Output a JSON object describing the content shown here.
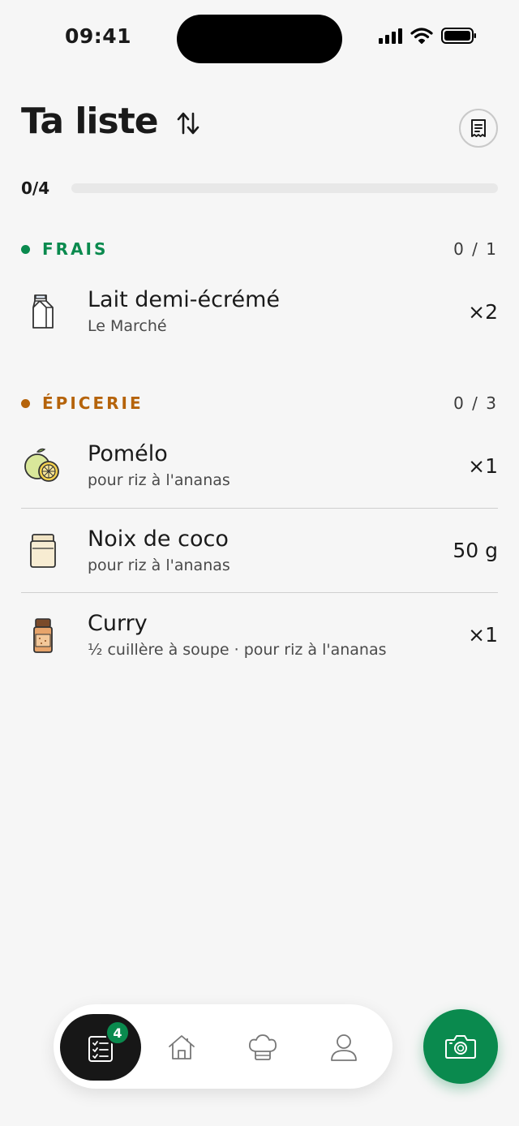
{
  "status_bar": {
    "time": "09:41"
  },
  "header": {
    "title": "Ta liste"
  },
  "progress": {
    "label": "0/4",
    "fraction": 0
  },
  "colors": {
    "accent": "#0a8a4e",
    "frais": "#0a8a4e",
    "epicerie": "#b5630a"
  },
  "sections": [
    {
      "name": "FRAIS",
      "count": "0 / 1",
      "items": [
        {
          "name": "Lait demi-écrémé",
          "sub": "Le Marché",
          "qty": "×2",
          "icon": "milk-carton-icon"
        }
      ]
    },
    {
      "name": "ÉPICERIE",
      "count": "0 / 3",
      "items": [
        {
          "name": "Pomélo",
          "sub": "pour riz à l'ananas",
          "qty": "×1",
          "icon": "pomelo-icon"
        },
        {
          "name": "Noix de coco",
          "sub": "pour riz à l'ananas",
          "qty": "50 g",
          "icon": "jar-icon"
        },
        {
          "name": "Curry",
          "sub": "½ cuillère à soupe · pour riz à l'ananas",
          "qty": "×1",
          "icon": "spice-jar-icon"
        }
      ]
    }
  ],
  "nav": {
    "badge": "4",
    "items": [
      "list-icon",
      "home-icon",
      "chef-hat-icon",
      "profile-icon"
    ]
  },
  "fab": {
    "icon": "camera-icon"
  }
}
